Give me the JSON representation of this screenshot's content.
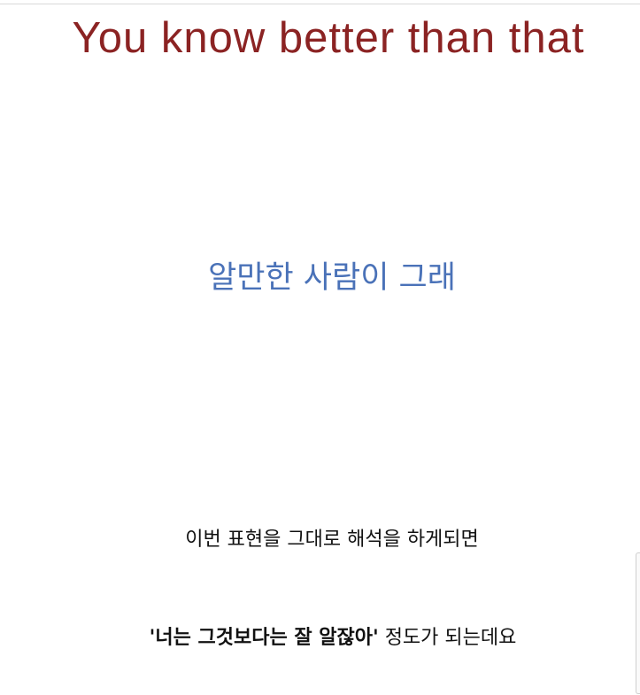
{
  "slide": {
    "title": "You know better than that",
    "subtitle": "알만한 사람이 그래",
    "line1": "이번 표현을 그대로 해석을 하게되면",
    "line2_quoted": "'너는 그것보다는 잘 알잖아'",
    "line2_rest": " 정도가 되는데요"
  },
  "colors": {
    "title": "#8b2323",
    "subtitle": "#4a72b8",
    "body": "#111111"
  }
}
